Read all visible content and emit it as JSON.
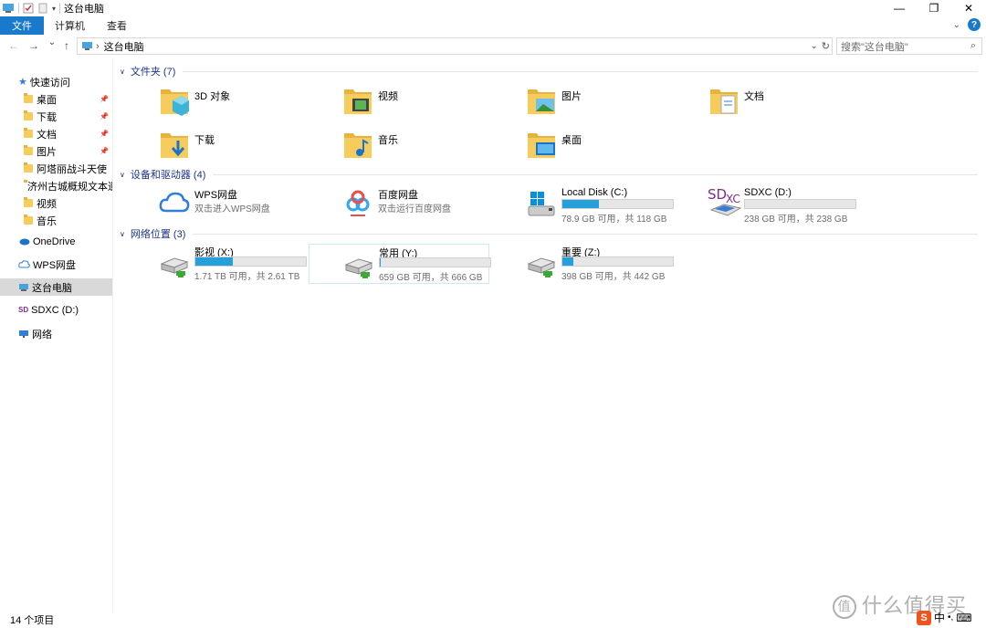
{
  "window": {
    "title": "这台电脑",
    "controls": {
      "minimize": "—",
      "maximize": "❐",
      "close": "✕"
    }
  },
  "ribbon": {
    "tabs": [
      "文件",
      "计算机",
      "查看"
    ],
    "help": "?"
  },
  "address": {
    "back": "←",
    "forward": "→",
    "recent": "⌄",
    "up": "↑",
    "breadcrumb_sep": "›",
    "path": "这台电脑",
    "dropdown": "⌄",
    "refresh": "↻",
    "search_placeholder": "搜索\"这台电脑\"",
    "search_icon": "⌕"
  },
  "sidebar": {
    "quick_access": "快速访问",
    "items": [
      {
        "label": "桌面",
        "pinned": true
      },
      {
        "label": "下载",
        "pinned": true
      },
      {
        "label": "文档",
        "pinned": true
      },
      {
        "label": "图片",
        "pinned": true
      },
      {
        "label": "阿塔丽战斗天使",
        "pinned": false
      },
      {
        "label": "济州古城概规文本遗",
        "pinned": false
      },
      {
        "label": "视频",
        "pinned": false
      },
      {
        "label": "音乐",
        "pinned": false
      }
    ],
    "pin_glyph": "📌",
    "onedrive": "OneDrive",
    "wps": "WPS网盘",
    "this_pc": "这台电脑",
    "sdxc": "SDXC (D:)",
    "network": "网络"
  },
  "groups": {
    "folders": "文件夹 (7)",
    "devices": "设备和驱动器 (4)",
    "network": "网络位置 (3)"
  },
  "folders": [
    {
      "name": "3D 对象",
      "kind": "3d"
    },
    {
      "name": "视频",
      "kind": "video"
    },
    {
      "name": "图片",
      "kind": "pictures"
    },
    {
      "name": "文档",
      "kind": "documents"
    },
    {
      "name": "下载",
      "kind": "downloads"
    },
    {
      "name": "音乐",
      "kind": "music"
    },
    {
      "name": "桌面",
      "kind": "desktop"
    }
  ],
  "devices": [
    {
      "name": "WPS网盘",
      "sub": "双击进入WPS网盘",
      "kind": "wps"
    },
    {
      "name": "百度网盘",
      "sub": "双击运行百度网盘",
      "kind": "baidu"
    },
    {
      "name": "Local Disk (C:)",
      "sub": "78.9 GB 可用，共 118 GB",
      "kind": "windisk",
      "used": 0.33
    },
    {
      "name": "SDXC (D:)",
      "sub": "238 GB 可用，共 238 GB",
      "kind": "sdxc",
      "used": 0.0
    }
  ],
  "network_drives": [
    {
      "name": "影视 (X:)",
      "sub": "1.71 TB 可用，共 2.61 TB",
      "used": 0.34
    },
    {
      "name": "常用 (Y:)",
      "sub": "659 GB 可用，共 666 GB",
      "used": 0.01
    },
    {
      "name": "重要 (Z:)",
      "sub": "398 GB 可用，共 442 GB",
      "used": 0.1
    }
  ],
  "status": "14 个项目",
  "watermark": "什么值得买",
  "watermark_logo": "值",
  "ime": {
    "logo": "S",
    "lang": "中",
    "punct": "•,",
    "keyboard": "⌨"
  }
}
